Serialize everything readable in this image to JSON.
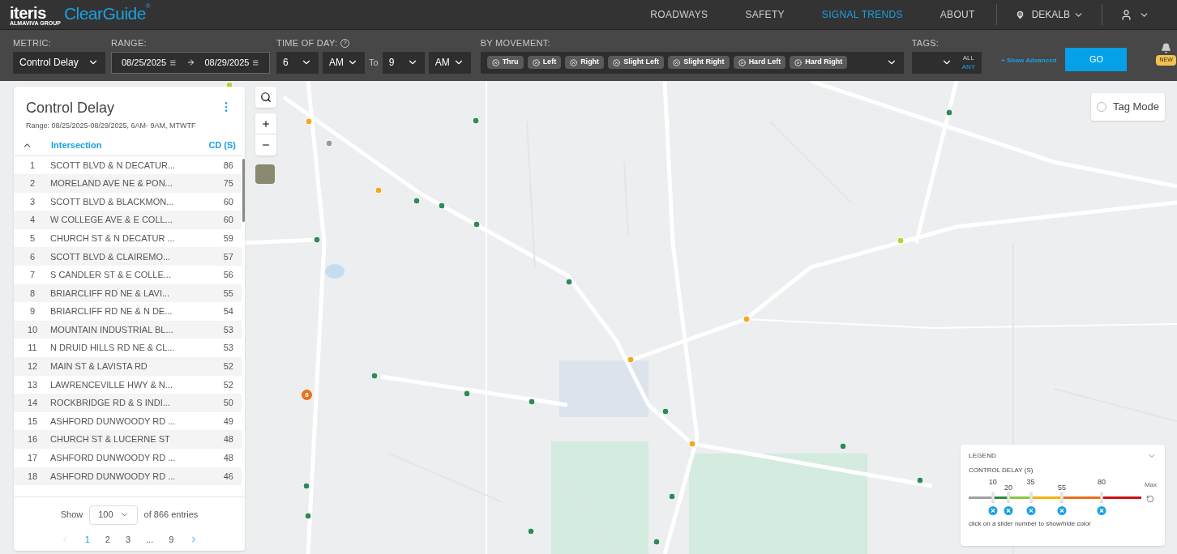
{
  "header": {
    "logo": {
      "brand": "iteris",
      "product": "ClearGuide",
      "tagline": "ALMAVIVA GROUP",
      "mark": "®"
    },
    "nav": [
      {
        "label": "ROADWAYS",
        "selected": false
      },
      {
        "label": "SAFETY",
        "selected": false
      },
      {
        "label": "SIGNAL TRENDS",
        "selected": true
      },
      {
        "label": "ABOUT",
        "selected": false
      }
    ],
    "region": "DEKALB"
  },
  "filters": {
    "metric": {
      "label": "METRIC:",
      "value": "Control Delay"
    },
    "range": {
      "label": "RANGE:",
      "start": "08/25/2025",
      "end": "08/29/2025"
    },
    "time_of_day": {
      "label": "TIME OF DAY:",
      "help": "?",
      "from_hour": "6",
      "from_ampm": "AM",
      "to_label": "To",
      "to_hour": "9",
      "to_ampm": "AM"
    },
    "movement": {
      "label": "BY MOVEMENT:",
      "chips": [
        "Thru",
        "Left",
        "Right",
        "Slight Left",
        "Slight Right",
        "Hard Left",
        "Hard Right"
      ]
    },
    "tags": {
      "label": "TAGS:",
      "modes": [
        {
          "label": "ALL",
          "selected": false
        },
        {
          "label": "ANY",
          "selected": true
        }
      ]
    },
    "show_advanced": "+ Show Advanced",
    "go": "GO",
    "notification_badge": "NEW"
  },
  "panel": {
    "title": "Control Delay",
    "subtitle": "Range: 08/25/2025-08/29/2025, 6AM- 9AM, MTWTF",
    "columns": [
      "Intersection",
      "CD (S)"
    ],
    "rows": [
      {
        "rank": "1",
        "name": "SCOTT BLVD & N DECATUR...",
        "cd": "86"
      },
      {
        "rank": "2",
        "name": "MORELAND AVE NE & PON...",
        "cd": "75"
      },
      {
        "rank": "3",
        "name": "SCOTT BLVD & BLACKMON...",
        "cd": "60"
      },
      {
        "rank": "4",
        "name": "W COLLEGE AVE & E COLL...",
        "cd": "60"
      },
      {
        "rank": "5",
        "name": "CHURCH ST & N DECATUR ...",
        "cd": "59"
      },
      {
        "rank": "6",
        "name": "SCOTT BLVD & CLAIREMO...",
        "cd": "57"
      },
      {
        "rank": "7",
        "name": "S CANDLER ST & E COLLE...",
        "cd": "56"
      },
      {
        "rank": "8",
        "name": "BRIARCLIFF RD NE & LAVI...",
        "cd": "55"
      },
      {
        "rank": "9",
        "name": "BRIARCLIFF RD NE & N DE...",
        "cd": "54"
      },
      {
        "rank": "10",
        "name": "MOUNTAIN INDUSTRIAL BL...",
        "cd": "53"
      },
      {
        "rank": "11",
        "name": "N DRUID HILLS RD NE & CL...",
        "cd": "53"
      },
      {
        "rank": "12",
        "name": "MAIN ST & LAVISTA RD",
        "cd": "52"
      },
      {
        "rank": "13",
        "name": "LAWRENCEVILLE HWY & N...",
        "cd": "52"
      },
      {
        "rank": "14",
        "name": "ROCKBRIDGE RD & S INDI...",
        "cd": "50"
      },
      {
        "rank": "15",
        "name": "ASHFORD DUNWOODY RD ...",
        "cd": "49"
      },
      {
        "rank": "16",
        "name": "CHURCH ST & LUCERNE ST",
        "cd": "48"
      },
      {
        "rank": "17",
        "name": "ASHFORD DUNWOODY RD ...",
        "cd": "48"
      },
      {
        "rank": "18",
        "name": "ASHFORD DUNWOODY RD ...",
        "cd": "46"
      }
    ],
    "show_label": "Show",
    "page_size": "100",
    "entries": "of 866 entries",
    "pages": [
      {
        "label": "1",
        "selected": true
      },
      {
        "label": "2",
        "selected": false
      },
      {
        "label": "3",
        "selected": false
      },
      {
        "label": "...",
        "selected": false
      },
      {
        "label": "9",
        "selected": false
      }
    ]
  },
  "map": {
    "cluster_count": "8",
    "tag_mode": {
      "label": "Tag Mode",
      "checked": false
    }
  },
  "legend": {
    "title": "LEGEND",
    "metric": "CONTROL DELAY (S)",
    "max_label": "Max",
    "hint": "click on a slider number to show/hide color",
    "segments": [
      {
        "color": "#a0a0a0"
      },
      {
        "color": "#2e8b3e"
      },
      {
        "color": "#8cc63f"
      },
      {
        "color": "#f5b400"
      },
      {
        "color": "#e8701a"
      },
      {
        "color": "#cc1010"
      }
    ],
    "thresholds": [
      {
        "label": "10",
        "level": 0.14
      },
      {
        "label": "20",
        "level": 0.23
      },
      {
        "label": "35",
        "level": 0.36
      },
      {
        "label": "55",
        "level": 0.54
      },
      {
        "label": "80",
        "level": 0.77
      }
    ]
  }
}
